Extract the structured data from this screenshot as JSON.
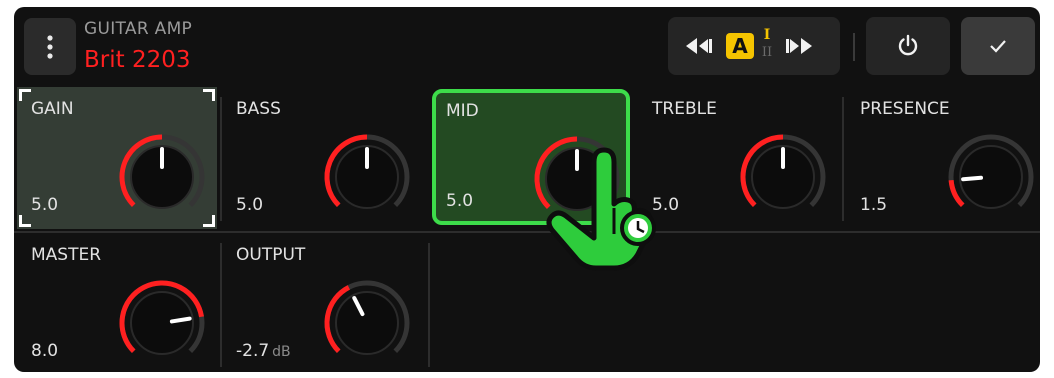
{
  "header": {
    "category": "GUITAR AMP",
    "model_name": "Brit 2203",
    "snapshot_labels": {
      "active": "A",
      "alt_top": "I",
      "alt_bottom": "II"
    }
  },
  "controls": [
    {
      "label": "GAIN",
      "value": "5.0",
      "unit": "",
      "level": 0.5,
      "state": "focused"
    },
    {
      "label": "BASS",
      "value": "5.0",
      "unit": "",
      "level": 0.5,
      "state": "normal"
    },
    {
      "label": "MID",
      "value": "5.0",
      "unit": "",
      "level": 0.5,
      "state": "pressed"
    },
    {
      "label": "TREBLE",
      "value": "5.0",
      "unit": "",
      "level": 0.5,
      "state": "normal"
    },
    {
      "label": "PRESENCE",
      "value": "1.5",
      "unit": "",
      "level": 0.15,
      "state": "normal"
    },
    {
      "label": "MASTER",
      "value": "8.0",
      "unit": "",
      "level": 0.8,
      "state": "normal"
    },
    {
      "label": "OUTPUT",
      "value": "-2.7",
      "unit": "dB",
      "level": 0.4,
      "state": "normal"
    }
  ],
  "colors": {
    "accent_red": "#ff2020",
    "snapshot_yellow": "#f5c400",
    "focus_green": "#3ddc4a",
    "pressed_fill": "#234a22",
    "focused_fill": "#343d35"
  },
  "icons": [
    "menu-dots-icon",
    "snapshot-prev-icon",
    "snapshot-next-icon",
    "power-icon",
    "checkmark-icon",
    "touch-hand-icon",
    "clock-icon"
  ]
}
